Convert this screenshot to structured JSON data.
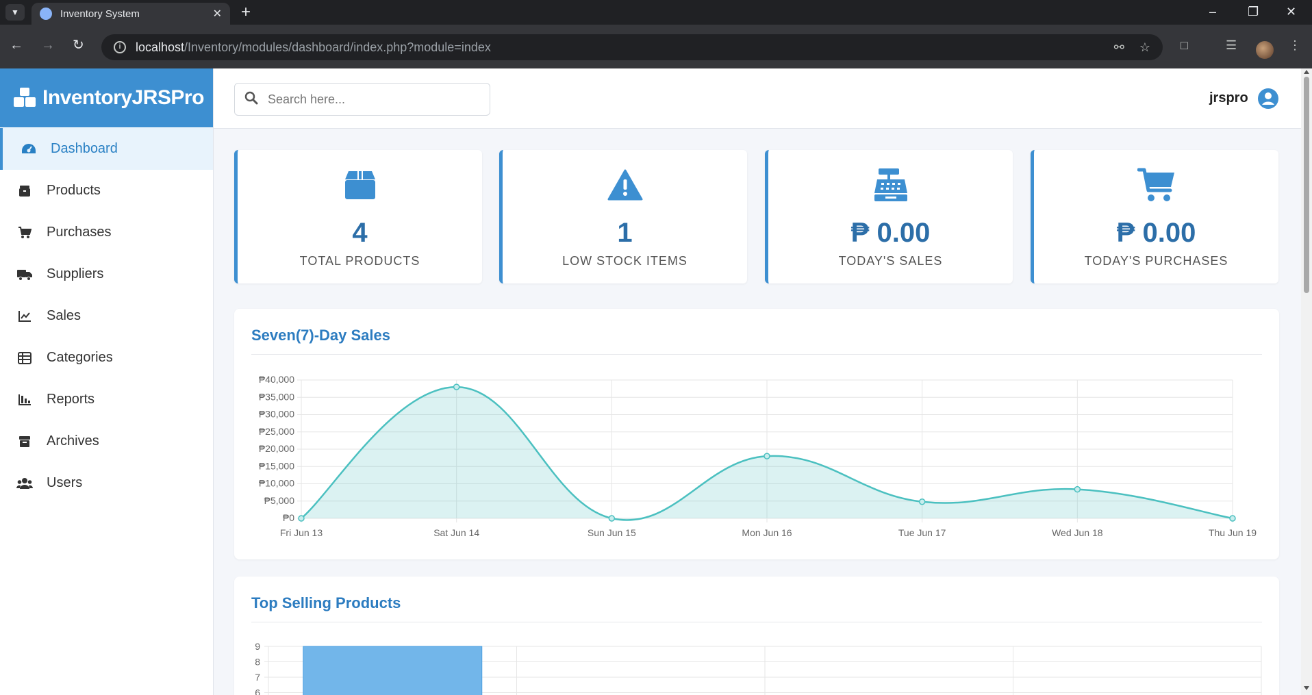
{
  "browser": {
    "tab_title": "Inventory System",
    "url_host": "localhost",
    "url_path": "/Inventory/modules/dashboard/index.php?module=index"
  },
  "sidebar": {
    "brand": "InventoryJRSPro",
    "items": [
      {
        "label": "Dashboard",
        "icon": "gauge-icon"
      },
      {
        "label": "Products",
        "icon": "box-icon"
      },
      {
        "label": "Purchases",
        "icon": "cart-icon"
      },
      {
        "label": "Suppliers",
        "icon": "truck-icon"
      },
      {
        "label": "Sales",
        "icon": "line-chart-icon"
      },
      {
        "label": "Categories",
        "icon": "table-list-icon"
      },
      {
        "label": "Reports",
        "icon": "bar-chart-icon"
      },
      {
        "label": "Archives",
        "icon": "archive-box-icon"
      },
      {
        "label": "Users",
        "icon": "users-icon"
      }
    ]
  },
  "topbar": {
    "search_placeholder": "Search here...",
    "username": "jrspro"
  },
  "cards": [
    {
      "value": "4",
      "label": "TOTAL PRODUCTS",
      "icon": "box-icon"
    },
    {
      "value": "1",
      "label": "LOW STOCK ITEMS",
      "icon": "warning-icon"
    },
    {
      "value": "₱ 0.00",
      "label": "TODAY'S SALES",
      "icon": "cash-register-icon"
    },
    {
      "value": "₱ 0.00",
      "label": "TODAY'S PURCHASES",
      "icon": "cart-icon"
    }
  ],
  "colors": {
    "accent": "#3d8fd1",
    "card_value": "#2c6ea8",
    "line": "#4bc0c0",
    "bar": "#72b6ea"
  },
  "sales_panel": {
    "title": "Seven(7)-Day Sales"
  },
  "top_panel": {
    "title": "Top Selling Products"
  },
  "chart_data": [
    {
      "type": "line",
      "title": "Seven(7)-Day Sales",
      "x": [
        "Fri Jun 13",
        "Sat Jun 14",
        "Sun Jun 15",
        "Mon Jun 16",
        "Tue Jun 17",
        "Wed Jun 18",
        "Thu Jun 19"
      ],
      "values": [
        0,
        38000,
        0,
        18000,
        4800,
        8400,
        0
      ],
      "ylim": [
        0,
        40000
      ],
      "yticks": [
        "₱0",
        "₱5,000",
        "₱10,000",
        "₱15,000",
        "₱20,000",
        "₱25,000",
        "₱30,000",
        "₱35,000",
        "₱40,000"
      ],
      "fill": true,
      "grid": true
    },
    {
      "type": "bar",
      "title": "Top Selling Products",
      "values": [
        9,
        0,
        0,
        0
      ],
      "ylim": [
        0,
        9
      ],
      "yticks_visible": [
        "9",
        "8",
        "7",
        "6"
      ],
      "grid": true
    }
  ]
}
